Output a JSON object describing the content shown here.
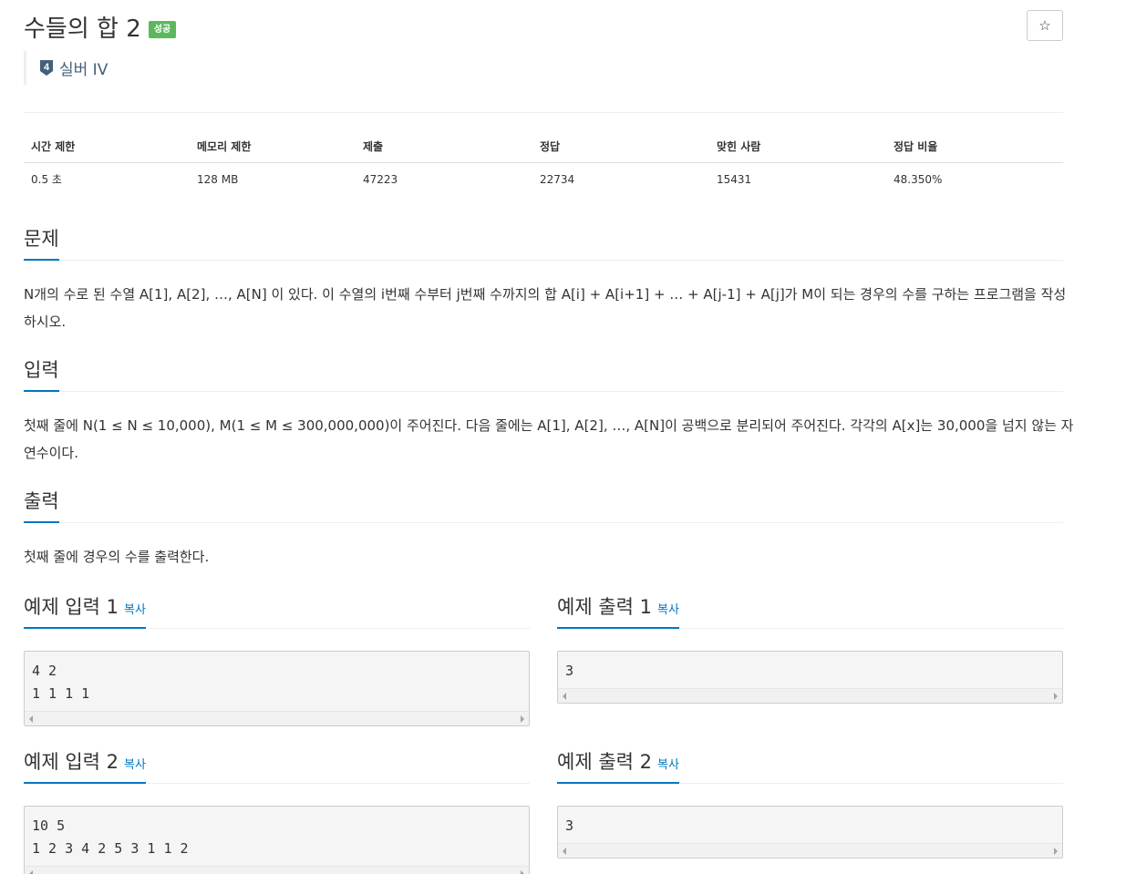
{
  "header": {
    "title": "수들의 합 2",
    "status_badge": "성공",
    "star_icon": "☆",
    "tier_number": "4",
    "tier_label": "실버 IV"
  },
  "stats": {
    "headers": [
      "시간 제한",
      "메모리 제한",
      "제출",
      "정답",
      "맞힌 사람",
      "정답 비율"
    ],
    "values": [
      "0.5 초",
      "128 MB",
      "47223",
      "22734",
      "15431",
      "48.350%"
    ]
  },
  "problem": {
    "heading": "문제",
    "line1": "N개의 수로 된 수열 A[1], A[2], …, A[N] 이 있다. 이 수열의 i번째 수부터 j번째 수까지의 합 A[i] + A[i+1] + … + A[j-1] + A[j]가 M이 되는 경우의 수를 구하는 프로그램을 작성",
    "line2": "하시오."
  },
  "input": {
    "heading": "입력",
    "line1": "첫째 줄에 N(1 ≤ N ≤ 10,000), M(1 ≤ M ≤ 300,000,000)이 주어진다. 다음 줄에는 A[1], A[2], …, A[N]이 공백으로 분리되어 주어진다. 각각의 A[x]는 30,000을 넘지 않는 자",
    "line2": "연수이다."
  },
  "output": {
    "heading": "출력",
    "text": "첫째 줄에 경우의 수를 출력한다."
  },
  "samples": {
    "copy_label": "복사",
    "input1": {
      "heading": "예제 입력 1",
      "content": "4 2\n1 1 1 1"
    },
    "output1": {
      "heading": "예제 출력 1",
      "content": "3"
    },
    "input2": {
      "heading": "예제 입력 2",
      "content": "10 5\n1 2 3 4 2 5 3 1 1 2"
    },
    "output2": {
      "heading": "예제 출력 2",
      "content": "3"
    }
  },
  "colors": {
    "accent": "#0076c0",
    "success_badge": "#5cb85c",
    "tier_silver": "#435f7a"
  }
}
